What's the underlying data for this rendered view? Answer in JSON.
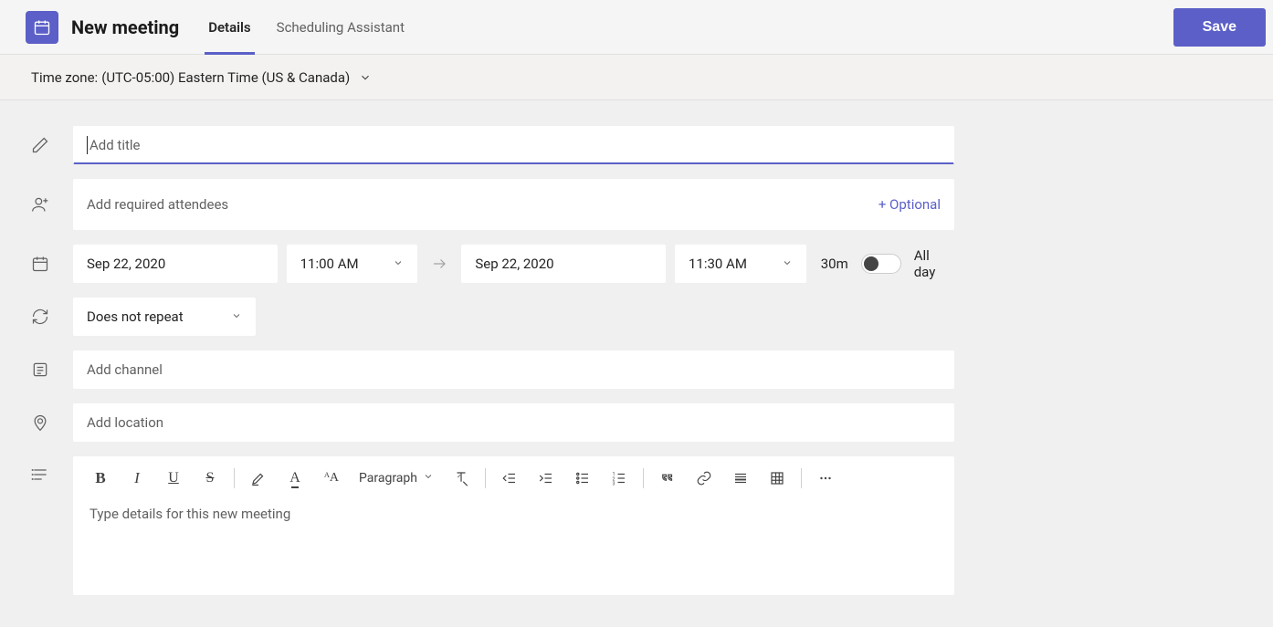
{
  "header": {
    "page_title": "New meeting",
    "tabs": [
      {
        "label": "Details",
        "active": true
      },
      {
        "label": "Scheduling Assistant",
        "active": false
      }
    ],
    "save_label": "Save"
  },
  "timezone": {
    "prefix": "Time zone:",
    "value": "(UTC-05:00) Eastern Time (US & Canada)"
  },
  "form": {
    "title": {
      "value": "",
      "placeholder": "Add title"
    },
    "attendees": {
      "placeholder": "Add required attendees",
      "optional_label": "+ Optional"
    },
    "start_date": "Sep 22, 2020",
    "start_time": "11:00 AM",
    "end_date": "Sep 22, 2020",
    "end_time": "11:30 AM",
    "duration_label": "30m",
    "all_day_label": "All day",
    "all_day_on": false,
    "repeat": "Does not repeat",
    "channel_placeholder": "Add channel",
    "location_placeholder": "Add location"
  },
  "editor": {
    "paragraph_label": "Paragraph",
    "body_placeholder": "Type details for this new meeting",
    "toolbar": {
      "bold": "B",
      "italic": "I",
      "underline": "U",
      "strike": "S",
      "font_color": "A",
      "font_size": "ᴬA"
    }
  }
}
